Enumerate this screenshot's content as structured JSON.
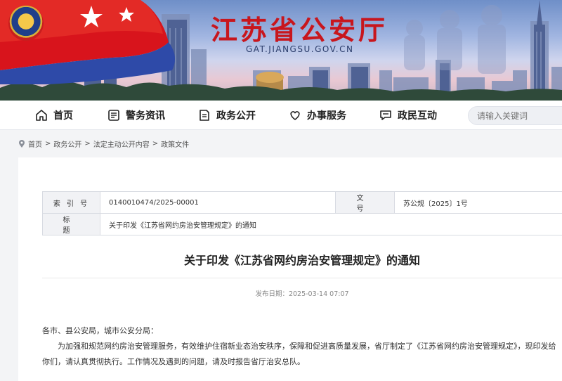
{
  "header": {
    "title": "江苏省公安厅",
    "url": "GAT.JIANGSU.GOV.CN"
  },
  "nav": {
    "items": [
      {
        "label": "首页",
        "icon": "home-icon"
      },
      {
        "label": "警务资讯",
        "icon": "news-icon"
      },
      {
        "label": "政务公开",
        "icon": "document-icon"
      },
      {
        "label": "办事服务",
        "icon": "heart-hand-icon"
      },
      {
        "label": "政民互动",
        "icon": "chat-icon"
      }
    ],
    "search_placeholder": "请输入关键词"
  },
  "breadcrumb": {
    "items": [
      "首页",
      "政务公开",
      "法定主动公开内容",
      "政策文件"
    ],
    "separator": ">"
  },
  "meta": {
    "index_label": "索 引 号",
    "index_value": "0140010474/2025-00001",
    "docno_label": "文 号",
    "docno_value": "苏公规〔2025〕1号",
    "title_label": "标 题",
    "title_value": "关于印发《江苏省网约房治安管理规定》的通知"
  },
  "article": {
    "title": "关于印发《江苏省网约房治安管理规定》的通知",
    "pubdate": "发布日期：2025-03-14 07:07",
    "salutation": "各市、县公安局，城市公安分局：",
    "paragraph": "为加强和规范网约房治安管理服务，有效维护住宿新业态治安秩序，保障和促进高质量发展，省厅制定了《江苏省网约房治安管理规定》，现印发给你们，请认真贯彻执行。工作情况及遇到的问题，请及时报告省厅治安总队。"
  },
  "colors": {
    "title_red": "#c8161d",
    "flag_red": "#d8141c",
    "sky_blue": "#6f8fc8"
  }
}
